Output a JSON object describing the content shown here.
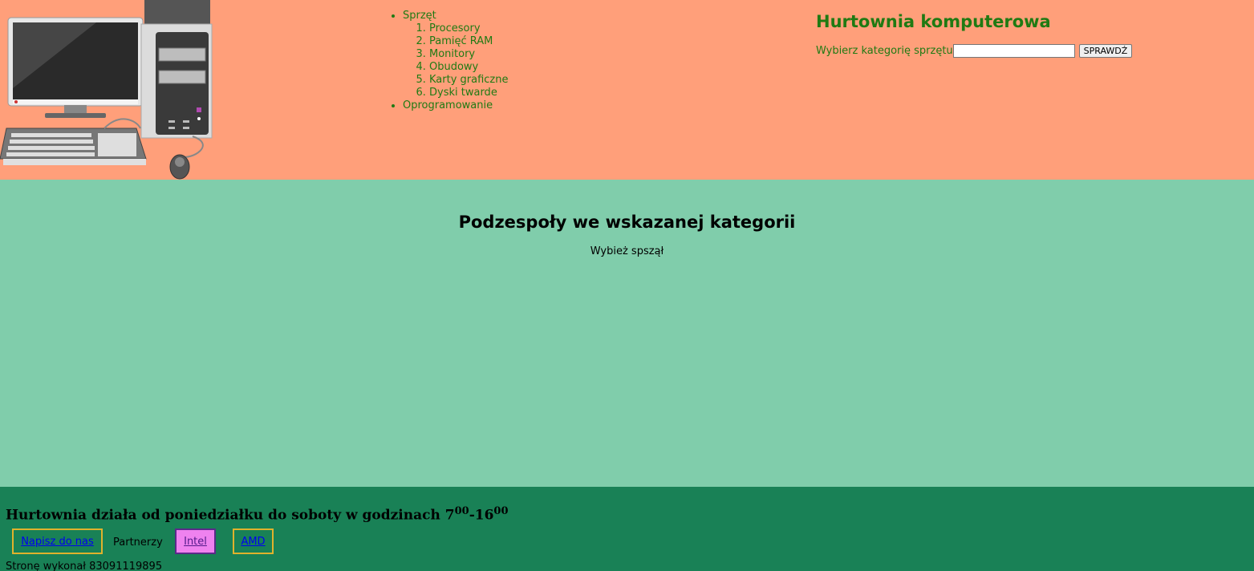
{
  "header": {
    "image_alt": "komputer",
    "nav": {
      "sections": [
        {
          "label": "Sprzęt",
          "items": [
            "Procesory",
            "Pamięć RAM",
            "Monitory",
            "Obudowy",
            "Karty graficzne",
            "Dyski twarde"
          ]
        },
        {
          "label": "Oprogramowanie"
        }
      ]
    },
    "title": "Hurtownia komputerowa",
    "form": {
      "label": "Wybierz kategorię sprzętu",
      "input_value": "",
      "button_label": "SPRAWDŹ"
    }
  },
  "main": {
    "title": "Podzespoły we wskazanej kategorii",
    "message": "Wybież spszął"
  },
  "footer": {
    "hours_text": "Hurtownia działa od poniedziałku do soboty w godzinach 7",
    "hours_start_sup": "00",
    "hours_dash": "-16",
    "hours_end_sup": "00",
    "contact_link": "Napisz do nas",
    "partners_label": "Partnerzy",
    "partner_links": [
      "Intel",
      "AMD"
    ],
    "author": "Stronę wykonał 83091119895"
  },
  "colors": {
    "header_bg": "#ff9f7a",
    "main_bg": "#80cdab",
    "footer_bg": "#198156",
    "accent_text": "#1f7a13"
  }
}
